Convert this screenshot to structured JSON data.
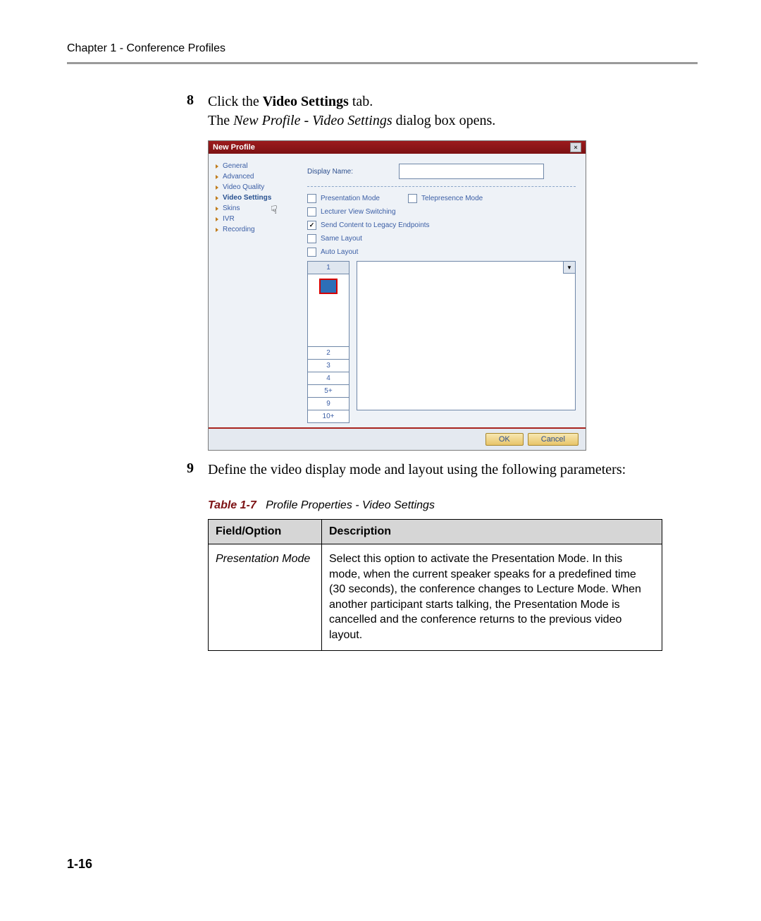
{
  "chapter_header": "Chapter 1 - Conference Profiles",
  "page_number": "1-16",
  "step8": {
    "num": "8",
    "pre": "Click the ",
    "bold": "Video Settings",
    "post": " tab.",
    "line2_pre": "The ",
    "line2_italic": "New Profile - Video Settings",
    "line2_post": " dialog box opens."
  },
  "step9": {
    "num": "9",
    "text": "Define the video display mode and layout using the following parameters:"
  },
  "dialog": {
    "title": "New Profile",
    "nav": [
      "General",
      "Advanced",
      "Video Quality",
      "Video Settings",
      "Skins",
      "IVR",
      "Recording"
    ],
    "nav_selected_index": 3,
    "display_name_label": "Display Name:",
    "display_name_value": "",
    "checks": {
      "presentation": "Presentation Mode",
      "telepresence": "Telepresence Mode",
      "lecturer": "Lecturer View Switching",
      "legacy": "Send Content to Legacy Endpoints",
      "legacy_checked": true,
      "same_layout": "Same Layout",
      "auto_layout": "Auto Layout"
    },
    "tabs": [
      "1",
      "2",
      "3",
      "4",
      "5+",
      "9",
      "10+"
    ],
    "ok": "OK",
    "cancel": "Cancel"
  },
  "table": {
    "caption_num": "Table 1-7",
    "caption_title": "Profile Properties - Video Settings",
    "head_field": "Field/Option",
    "head_desc": "Description",
    "rows": [
      {
        "field": "Presentation Mode",
        "desc": "Select this option to activate the Presentation Mode. In this mode, when the current speaker speaks for a predefined time (30 seconds), the conference changes to Lecture Mode. When another participant starts talking, the Presentation Mode is cancelled and the conference returns to the previous video layout."
      }
    ]
  }
}
